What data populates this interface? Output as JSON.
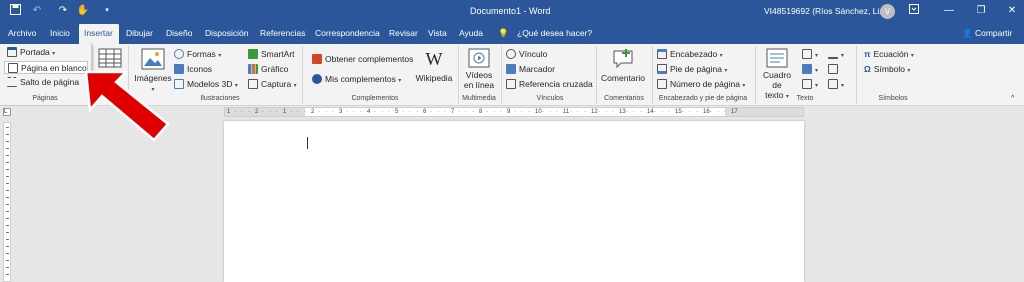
{
  "title_bar": {
    "document_title": "Documento1  -  Word",
    "user_name": "VI48519692 (Ríos Sánchez, Liz)",
    "avatar_initial": "V",
    "quick_access": [
      "save-icon",
      "undo-icon",
      "redo-icon",
      "touch-mode-icon",
      "customize-icon"
    ]
  },
  "tabs": [
    "Archivo",
    "Inicio",
    "Insertar",
    "Dibujar",
    "Diseño",
    "Disposición",
    "Referencias",
    "Correspondencia",
    "Revisar",
    "Vista",
    "Ayuda"
  ],
  "active_tab": "Insertar",
  "tell_me": "¿Qué desea hacer?",
  "share_label": "Compartir",
  "pages_menu": {
    "items": [
      "Portada",
      "Página en blanco",
      "Salto de página"
    ],
    "group_label": "Páginas",
    "highlighted": "Página en blanco"
  },
  "ribbon": {
    "tables_label": "Tabla",
    "illustrations": {
      "images": "Imágenes",
      "shapes": "Formas",
      "icons": "Iconos",
      "models3d": "Modelos 3D",
      "smartart": "SmartArt",
      "chart": "Gráfico",
      "screenshot": "Captura",
      "group_label": "Ilustraciones"
    },
    "addins": {
      "get": "Obtener complementos",
      "mine": "Mis complementos",
      "wikipedia": "Wikipedia",
      "group_label": "Complementos"
    },
    "media": {
      "online_video_1": "Vídeos",
      "online_video_2": "en línea",
      "group_label": "Multimedia"
    },
    "links": {
      "link": "Vínculo",
      "bookmark": "Marcador",
      "cross_ref": "Referencia cruzada",
      "group_label": "Vínculos"
    },
    "comments": {
      "comment": "Comentario",
      "group_label": "Comentarios"
    },
    "header_footer": {
      "header": "Encabezado",
      "footer": "Pie de página",
      "page_number": "Número de página",
      "group_label": "Encabezado y pie de página"
    },
    "text": {
      "textbox_1": "Cuadro de",
      "textbox_2": "texto",
      "group_label": "Texto"
    },
    "symbols": {
      "equation": "Ecuación",
      "symbol": "Símbolo",
      "group_label": "Símbolos"
    }
  },
  "ruler_numbers": [
    "1",
    "·",
    "·",
    "·",
    "2",
    "·",
    "·",
    "·",
    "1",
    "·",
    "·",
    "·",
    "2",
    "·",
    "·",
    "·",
    "3",
    "·",
    "·",
    "·",
    "4",
    "·",
    "·",
    "·",
    "5",
    "·",
    "·",
    "·",
    "6",
    "·",
    "·",
    "·",
    "7",
    "·",
    "·",
    "·",
    "8",
    "·",
    "·",
    "·",
    "9",
    "·",
    "·",
    "·",
    "10",
    "·",
    "·",
    "·",
    "11",
    "·",
    "·",
    "·",
    "12",
    "·",
    "·",
    "·",
    "13",
    "·",
    "·",
    "·",
    "14",
    "·",
    "·",
    "·",
    "15",
    "·",
    "·",
    "·",
    "16",
    "·",
    "·",
    "·",
    "17"
  ],
  "colors": {
    "titlebar": "#2b579a",
    "annotation_arrow": "#e00000"
  }
}
